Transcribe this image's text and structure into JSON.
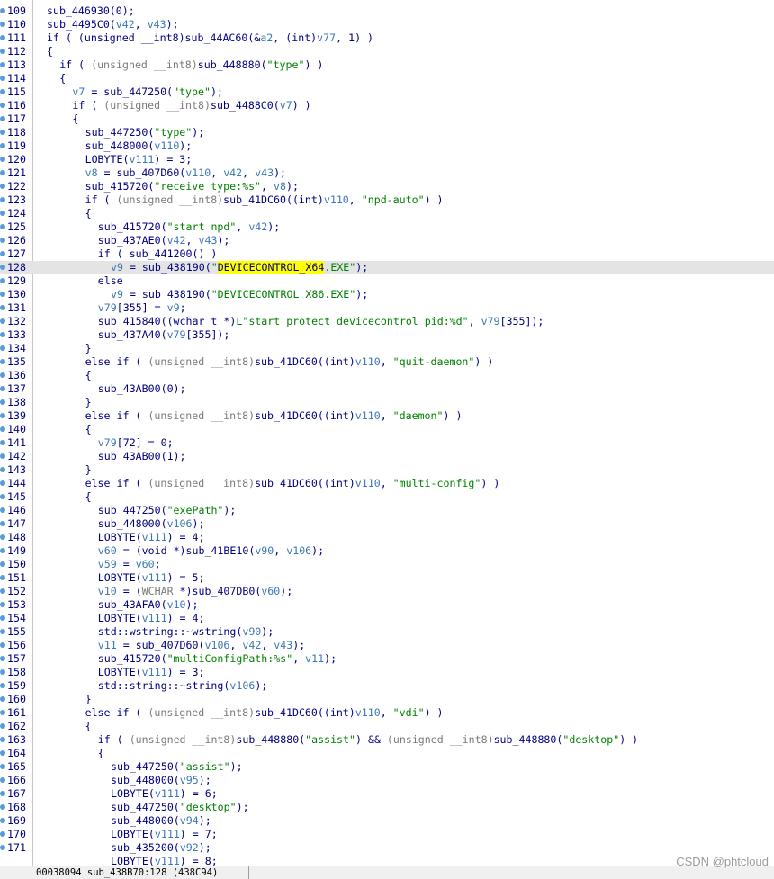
{
  "lines": [
    {
      "n": "109",
      "indent": 0,
      "tokens": [
        [
          "p",
          "sub_446930(0);"
        ]
      ]
    },
    {
      "n": "110",
      "indent": 0,
      "tokens": [
        [
          "p",
          "sub_4495C0("
        ],
        [
          "v",
          "v42"
        ],
        [
          "p",
          ", "
        ],
        [
          "v",
          "v43"
        ],
        [
          "p",
          ");"
        ]
      ]
    },
    {
      "n": "111",
      "indent": 0,
      "tokens": [
        [
          "p",
          "if ( (unsigned __int8)sub_44AC60(&"
        ],
        [
          "v",
          "a2"
        ],
        [
          "p",
          ", (int)"
        ],
        [
          "v",
          "v77"
        ],
        [
          "p",
          ", 1) )"
        ]
      ]
    },
    {
      "n": "112",
      "indent": 0,
      "tokens": [
        [
          "p",
          "{"
        ]
      ]
    },
    {
      "n": "113",
      "indent": 1,
      "tokens": [
        [
          "p",
          "if ( "
        ],
        [
          "m",
          "(unsigned __int8)"
        ],
        [
          "p",
          "sub_448880("
        ],
        [
          "s",
          "\"type\""
        ],
        [
          "p",
          ") )"
        ]
      ]
    },
    {
      "n": "114",
      "indent": 1,
      "tokens": [
        [
          "p",
          "{"
        ]
      ]
    },
    {
      "n": "115",
      "indent": 2,
      "tokens": [
        [
          "v",
          "v7"
        ],
        [
          "p",
          " = sub_447250("
        ],
        [
          "s",
          "\"type\""
        ],
        [
          "p",
          ");"
        ]
      ]
    },
    {
      "n": "116",
      "indent": 2,
      "tokens": [
        [
          "p",
          "if ( "
        ],
        [
          "m",
          "(unsigned __int8)"
        ],
        [
          "p",
          "sub_4488C0("
        ],
        [
          "v",
          "v7"
        ],
        [
          "p",
          ") )"
        ]
      ]
    },
    {
      "n": "117",
      "indent": 2,
      "tokens": [
        [
          "p",
          "{"
        ]
      ]
    },
    {
      "n": "118",
      "indent": 3,
      "tokens": [
        [
          "p",
          "sub_447250("
        ],
        [
          "s",
          "\"type\""
        ],
        [
          "p",
          ");"
        ]
      ]
    },
    {
      "n": "119",
      "indent": 3,
      "tokens": [
        [
          "p",
          "sub_448000("
        ],
        [
          "v",
          "v110"
        ],
        [
          "p",
          ");"
        ]
      ]
    },
    {
      "n": "120",
      "indent": 3,
      "tokens": [
        [
          "p",
          "LOBYTE("
        ],
        [
          "v",
          "v111"
        ],
        [
          "p",
          ") = 3;"
        ]
      ]
    },
    {
      "n": "121",
      "indent": 3,
      "tokens": [
        [
          "v",
          "v8"
        ],
        [
          "p",
          " = sub_407D60("
        ],
        [
          "v",
          "v110"
        ],
        [
          "p",
          ", "
        ],
        [
          "v",
          "v42"
        ],
        [
          "p",
          ", "
        ],
        [
          "v",
          "v43"
        ],
        [
          "p",
          ");"
        ]
      ]
    },
    {
      "n": "122",
      "indent": 3,
      "tokens": [
        [
          "p",
          "sub_415720("
        ],
        [
          "s",
          "\"receive type:%s\""
        ],
        [
          "p",
          ", "
        ],
        [
          "v",
          "v8"
        ],
        [
          "p",
          ");"
        ]
      ]
    },
    {
      "n": "123",
      "indent": 3,
      "tokens": [
        [
          "p",
          "if ( "
        ],
        [
          "m",
          "(unsigned __int8)"
        ],
        [
          "p",
          "sub_41DC60((int)"
        ],
        [
          "v",
          "v110"
        ],
        [
          "p",
          ", "
        ],
        [
          "s",
          "\"npd-auto\""
        ],
        [
          "p",
          ") )"
        ]
      ]
    },
    {
      "n": "124",
      "indent": 3,
      "tokens": [
        [
          "p",
          "{"
        ]
      ]
    },
    {
      "n": "125",
      "indent": 4,
      "tokens": [
        [
          "p",
          "sub_415720("
        ],
        [
          "s",
          "\"start npd\""
        ],
        [
          "p",
          ", "
        ],
        [
          "v",
          "v42"
        ],
        [
          "p",
          ");"
        ]
      ]
    },
    {
      "n": "126",
      "indent": 4,
      "tokens": [
        [
          "p",
          "sub_437AE0("
        ],
        [
          "v",
          "v42"
        ],
        [
          "p",
          ", "
        ],
        [
          "v",
          "v43"
        ],
        [
          "p",
          ");"
        ]
      ]
    },
    {
      "n": "127",
      "indent": 4,
      "tokens": [
        [
          "p",
          "if ( sub_441200() )"
        ]
      ]
    },
    {
      "n": "128",
      "indent": 5,
      "hl": true,
      "tokens": [
        [
          "v",
          "v9"
        ],
        [
          "p",
          " = sub_438190("
        ],
        [
          "s",
          "\""
        ],
        [
          "x",
          "DEVICECONTROL_X64"
        ],
        [
          "s",
          ".EXE\""
        ],
        [
          "p",
          ");"
        ]
      ]
    },
    {
      "n": "129",
      "indent": 4,
      "tokens": [
        [
          "p",
          "else"
        ]
      ]
    },
    {
      "n": "130",
      "indent": 5,
      "tokens": [
        [
          "v",
          "v9"
        ],
        [
          "p",
          " = sub_438190("
        ],
        [
          "s",
          "\"DEVICECONTROL_X86.EXE\""
        ],
        [
          "p",
          ");"
        ]
      ]
    },
    {
      "n": "131",
      "indent": 4,
      "tokens": [
        [
          "v",
          "v79"
        ],
        [
          "p",
          "[355] = "
        ],
        [
          "v",
          "v9"
        ],
        [
          "p",
          ";"
        ]
      ]
    },
    {
      "n": "132",
      "indent": 4,
      "tokens": [
        [
          "p",
          "sub_415840((wchar_t *)"
        ],
        [
          "s",
          "L\"start protect devicecontrol pid:%d\""
        ],
        [
          "p",
          ", "
        ],
        [
          "v",
          "v79"
        ],
        [
          "p",
          "[355]);"
        ]
      ]
    },
    {
      "n": "133",
      "indent": 4,
      "tokens": [
        [
          "p",
          "sub_437A40("
        ],
        [
          "v",
          "v79"
        ],
        [
          "p",
          "[355]);"
        ]
      ]
    },
    {
      "n": "134",
      "indent": 3,
      "tokens": [
        [
          "p",
          "}"
        ]
      ]
    },
    {
      "n": "135",
      "indent": 3,
      "tokens": [
        [
          "p",
          "else if ( "
        ],
        [
          "m",
          "(unsigned __int8)"
        ],
        [
          "p",
          "sub_41DC60((int)"
        ],
        [
          "v",
          "v110"
        ],
        [
          "p",
          ", "
        ],
        [
          "s",
          "\"quit-daemon\""
        ],
        [
          "p",
          ") )"
        ]
      ]
    },
    {
      "n": "136",
      "indent": 3,
      "tokens": [
        [
          "p",
          "{"
        ]
      ]
    },
    {
      "n": "137",
      "indent": 4,
      "tokens": [
        [
          "p",
          "sub_43AB00(0);"
        ]
      ]
    },
    {
      "n": "138",
      "indent": 3,
      "tokens": [
        [
          "p",
          "}"
        ]
      ]
    },
    {
      "n": "139",
      "indent": 3,
      "tokens": [
        [
          "p",
          "else if ( "
        ],
        [
          "m",
          "(unsigned __int8)"
        ],
        [
          "p",
          "sub_41DC60((int)"
        ],
        [
          "v",
          "v110"
        ],
        [
          "p",
          ", "
        ],
        [
          "s",
          "\"daemon\""
        ],
        [
          "p",
          ") )"
        ]
      ]
    },
    {
      "n": "140",
      "indent": 3,
      "tokens": [
        [
          "p",
          "{"
        ]
      ]
    },
    {
      "n": "141",
      "indent": 4,
      "tokens": [
        [
          "v",
          "v79"
        ],
        [
          "p",
          "[72] = 0;"
        ]
      ]
    },
    {
      "n": "142",
      "indent": 4,
      "tokens": [
        [
          "p",
          "sub_43AB00(1);"
        ]
      ]
    },
    {
      "n": "143",
      "indent": 3,
      "tokens": [
        [
          "p",
          "}"
        ]
      ]
    },
    {
      "n": "144",
      "indent": 3,
      "tokens": [
        [
          "p",
          "else if ( "
        ],
        [
          "m",
          "(unsigned __int8)"
        ],
        [
          "p",
          "sub_41DC60((int)"
        ],
        [
          "v",
          "v110"
        ],
        [
          "p",
          ", "
        ],
        [
          "s",
          "\"multi-config\""
        ],
        [
          "p",
          ") )"
        ]
      ]
    },
    {
      "n": "145",
      "indent": 3,
      "tokens": [
        [
          "p",
          "{"
        ]
      ]
    },
    {
      "n": "146",
      "indent": 4,
      "tokens": [
        [
          "p",
          "sub_447250("
        ],
        [
          "s",
          "\"exePath\""
        ],
        [
          "p",
          ");"
        ]
      ]
    },
    {
      "n": "147",
      "indent": 4,
      "tokens": [
        [
          "p",
          "sub_448000("
        ],
        [
          "v",
          "v106"
        ],
        [
          "p",
          ");"
        ]
      ]
    },
    {
      "n": "148",
      "indent": 4,
      "tokens": [
        [
          "p",
          "LOBYTE("
        ],
        [
          "v",
          "v111"
        ],
        [
          "p",
          ") = 4;"
        ]
      ]
    },
    {
      "n": "149",
      "indent": 4,
      "tokens": [
        [
          "v",
          "v60"
        ],
        [
          "p",
          " = (void *)sub_41BE10("
        ],
        [
          "v",
          "v90"
        ],
        [
          "p",
          ", "
        ],
        [
          "v",
          "v106"
        ],
        [
          "p",
          ");"
        ]
      ]
    },
    {
      "n": "150",
      "indent": 4,
      "tokens": [
        [
          "v",
          "v59"
        ],
        [
          "p",
          " = "
        ],
        [
          "v",
          "v60"
        ],
        [
          "p",
          ";"
        ]
      ]
    },
    {
      "n": "151",
      "indent": 4,
      "tokens": [
        [
          "p",
          "LOBYTE("
        ],
        [
          "v",
          "v111"
        ],
        [
          "p",
          ") = 5;"
        ]
      ]
    },
    {
      "n": "152",
      "indent": 4,
      "tokens": [
        [
          "v",
          "v10"
        ],
        [
          "p",
          " = ("
        ],
        [
          "m",
          "WCHAR"
        ],
        [
          "p",
          " *)sub_407DB0("
        ],
        [
          "v",
          "v60"
        ],
        [
          "p",
          ");"
        ]
      ]
    },
    {
      "n": "153",
      "indent": 4,
      "tokens": [
        [
          "p",
          "sub_43AFA0("
        ],
        [
          "v",
          "v10"
        ],
        [
          "p",
          ");"
        ]
      ]
    },
    {
      "n": "154",
      "indent": 4,
      "tokens": [
        [
          "p",
          "LOBYTE("
        ],
        [
          "v",
          "v111"
        ],
        [
          "p",
          ") = 4;"
        ]
      ]
    },
    {
      "n": "155",
      "indent": 4,
      "tokens": [
        [
          "p",
          "std::wstring::~wstring("
        ],
        [
          "v",
          "v90"
        ],
        [
          "p",
          ");"
        ]
      ]
    },
    {
      "n": "156",
      "indent": 4,
      "tokens": [
        [
          "v",
          "v11"
        ],
        [
          "p",
          " = sub_407D60("
        ],
        [
          "v",
          "v106"
        ],
        [
          "p",
          ", "
        ],
        [
          "v",
          "v42"
        ],
        [
          "p",
          ", "
        ],
        [
          "v",
          "v43"
        ],
        [
          "p",
          ");"
        ]
      ]
    },
    {
      "n": "157",
      "indent": 4,
      "tokens": [
        [
          "p",
          "sub_415720("
        ],
        [
          "s",
          "\"multiConfigPath:%s\""
        ],
        [
          "p",
          ", "
        ],
        [
          "v",
          "v11"
        ],
        [
          "p",
          ");"
        ]
      ]
    },
    {
      "n": "158",
      "indent": 4,
      "tokens": [
        [
          "p",
          "LOBYTE("
        ],
        [
          "v",
          "v111"
        ],
        [
          "p",
          ") = 3;"
        ]
      ]
    },
    {
      "n": "159",
      "indent": 4,
      "tokens": [
        [
          "p",
          "std::string::~string("
        ],
        [
          "v",
          "v106"
        ],
        [
          "p",
          ");"
        ]
      ]
    },
    {
      "n": "160",
      "indent": 3,
      "tokens": [
        [
          "p",
          "}"
        ]
      ]
    },
    {
      "n": "161",
      "indent": 3,
      "tokens": [
        [
          "p",
          "else if ( "
        ],
        [
          "m",
          "(unsigned __int8)"
        ],
        [
          "p",
          "sub_41DC60((int)"
        ],
        [
          "v",
          "v110"
        ],
        [
          "p",
          ", "
        ],
        [
          "s",
          "\"vdi\""
        ],
        [
          "p",
          ") )"
        ]
      ]
    },
    {
      "n": "162",
      "indent": 3,
      "tokens": [
        [
          "p",
          "{"
        ]
      ]
    },
    {
      "n": "163",
      "indent": 4,
      "tokens": [
        [
          "p",
          "if ( "
        ],
        [
          "m",
          "(unsigned __int8)"
        ],
        [
          "p",
          "sub_448880("
        ],
        [
          "s",
          "\"assist\""
        ],
        [
          "p",
          ") && "
        ],
        [
          "m",
          "(unsigned __int8)"
        ],
        [
          "p",
          "sub_448880("
        ],
        [
          "s",
          "\"desktop\""
        ],
        [
          "p",
          ") )"
        ]
      ]
    },
    {
      "n": "164",
      "indent": 4,
      "tokens": [
        [
          "p",
          "{"
        ]
      ]
    },
    {
      "n": "165",
      "indent": 5,
      "tokens": [
        [
          "p",
          "sub_447250("
        ],
        [
          "s",
          "\"assist\""
        ],
        [
          "p",
          ");"
        ]
      ]
    },
    {
      "n": "166",
      "indent": 5,
      "tokens": [
        [
          "p",
          "sub_448000("
        ],
        [
          "v",
          "v95"
        ],
        [
          "p",
          ");"
        ]
      ]
    },
    {
      "n": "167",
      "indent": 5,
      "tokens": [
        [
          "p",
          "LOBYTE("
        ],
        [
          "v",
          "v111"
        ],
        [
          "p",
          ") = 6;"
        ]
      ]
    },
    {
      "n": "168",
      "indent": 5,
      "tokens": [
        [
          "p",
          "sub_447250("
        ],
        [
          "s",
          "\"desktop\""
        ],
        [
          "p",
          ");"
        ]
      ]
    },
    {
      "n": "169",
      "indent": 5,
      "tokens": [
        [
          "p",
          "sub_448000("
        ],
        [
          "v",
          "v94"
        ],
        [
          "p",
          ");"
        ]
      ]
    },
    {
      "n": "170",
      "indent": 5,
      "tokens": [
        [
          "p",
          "LOBYTE("
        ],
        [
          "v",
          "v111"
        ],
        [
          "p",
          ") = 7;"
        ]
      ]
    },
    {
      "n": "171",
      "indent": 5,
      "tokens": [
        [
          "p",
          "sub_435200("
        ],
        [
          "v",
          "v92"
        ],
        [
          "p",
          ");"
        ]
      ]
    },
    {
      "n": "",
      "indent": 5,
      "tokens": [
        [
          "p",
          "LOBYTE("
        ],
        [
          "v",
          "v111"
        ],
        [
          "p",
          ") = 8;"
        ]
      ]
    }
  ],
  "status_bar": {
    "text": "00038094 sub_438B70:128 (438C94)"
  },
  "watermark": "CSDN @phtcloud",
  "colors": {
    "plain": "#000080",
    "variable": "#3c78b4",
    "string": "#008000",
    "muted": "#7a7a7a",
    "highlight_line": "#e4e4e4",
    "search_mark": "#ffff00",
    "breakpoint_dot": "#5a9bd6"
  }
}
